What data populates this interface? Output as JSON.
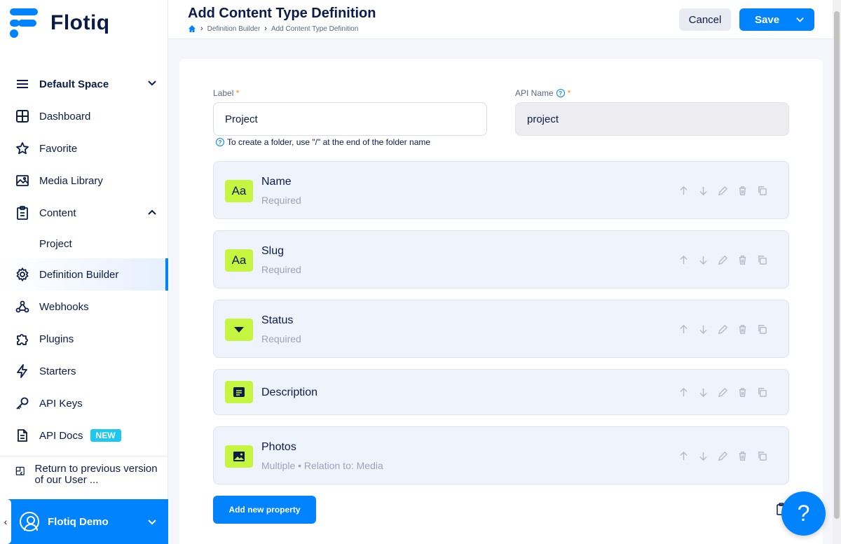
{
  "app": {
    "logo_text": "Flotiq"
  },
  "sidebar": {
    "space": "Default Space",
    "items": [
      {
        "label": "Dashboard"
      },
      {
        "label": "Favorite"
      },
      {
        "label": "Media Library"
      },
      {
        "label": "Content"
      },
      {
        "label": "Project"
      },
      {
        "label": "Definition Builder"
      },
      {
        "label": "Webhooks"
      },
      {
        "label": "Plugins"
      },
      {
        "label": "Starters"
      },
      {
        "label": "API Keys"
      },
      {
        "label": "API Docs",
        "badge": "NEW"
      }
    ],
    "return_label": "Return to previous version of our User ...",
    "user_name": "Flotiq Demo"
  },
  "header": {
    "title": "Add Content Type Definition",
    "breadcrumb": [
      "Definition Builder",
      "Add Content Type Definition"
    ],
    "cancel_label": "Cancel",
    "save_label": "Save"
  },
  "form": {
    "label_field": {
      "label": "Label",
      "required": "*",
      "value": "Project"
    },
    "api_name_field": {
      "label": "API Name",
      "required": "*",
      "value": "project"
    },
    "help_text": "To create a folder, use \"/\" at the end of the folder name"
  },
  "properties": [
    {
      "name": "Name",
      "sub": "Required",
      "icon": "text-icon"
    },
    {
      "name": "Slug",
      "sub": "Required",
      "icon": "text-icon"
    },
    {
      "name": "Status",
      "sub": "Required",
      "icon": "select-icon"
    },
    {
      "name": "Description",
      "sub": "",
      "icon": "richtext-icon"
    },
    {
      "name": "Photos",
      "sub": "Multiple • Relation to: Media",
      "icon": "image-icon"
    }
  ],
  "add_property_label": "Add new property",
  "help_fab": "?",
  "colors": {
    "accent": "#0083fc",
    "lime": "#c6f53f",
    "navy": "#0b1c4a"
  }
}
